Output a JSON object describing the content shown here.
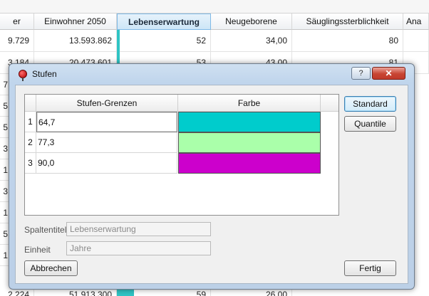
{
  "background_table": {
    "headers": [
      {
        "label": "er",
        "selected": false
      },
      {
        "label": "Einwohner 2050",
        "selected": false
      },
      {
        "label": "Lebenserwartung",
        "selected": true
      },
      {
        "label": "Neugeborene",
        "selected": false
      },
      {
        "label": "Säuglingssterblichkeit",
        "selected": false
      },
      {
        "label": "Ana",
        "selected": false
      }
    ],
    "rows": [
      [
        "9.729",
        "13.593.862",
        "52",
        "34,00",
        "80",
        ""
      ],
      [
        "3.184",
        "20.473.601",
        "53",
        "43,00",
        "81",
        ""
      ]
    ],
    "partial_left_cells": [
      "7",
      "5",
      "5",
      "3",
      "1",
      "3",
      "1",
      "5",
      "1"
    ],
    "partial_bottom_row": [
      "2.224",
      "51.913.300",
      "59",
      "26,00",
      "",
      ""
    ]
  },
  "dialog": {
    "title": "Stufen",
    "help_label": "?",
    "close_label": "✕",
    "columns": [
      "Stufen-Grenzen",
      "Farbe"
    ],
    "rows": [
      {
        "index": "1",
        "value": "64,7",
        "color": "#00cccc"
      },
      {
        "index": "2",
        "value": "77,3",
        "color": "#aaffaa"
      },
      {
        "index": "3",
        "value": "90,0",
        "color": "#cc00cc"
      }
    ],
    "spaltentitel_label": "Spaltentitel",
    "spaltentitel_value": "Lebenserwartung",
    "einheit_label": "Einheit",
    "einheit_value": "Jahre",
    "buttons": {
      "standard": "Standard",
      "quantile": "Quantile",
      "abbrechen": "Abbrechen",
      "fertig": "Fertig"
    }
  },
  "icons": {
    "title": "pushpin-icon"
  }
}
